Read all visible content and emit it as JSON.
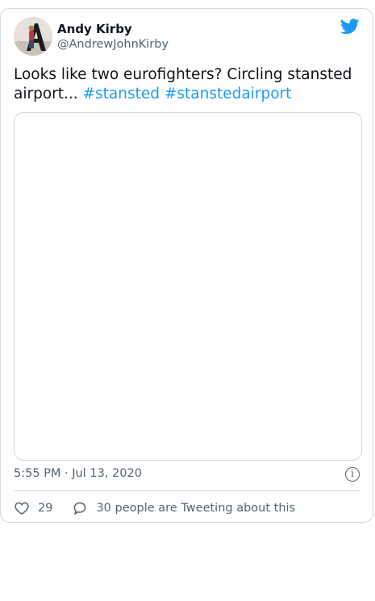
{
  "tweet": {
    "author_name": "Andy Kirby",
    "author_handle": "@AndrewJohnKirby",
    "text_prefix": "Looks like two eurofighters? Circling stansted airport... ",
    "hashtags": [
      "#stansted",
      "#stanstedairport"
    ],
    "timestamp": "5:55 PM · Jul 13, 2020",
    "likes": "29",
    "conversation_text": "30 people are Tweeting about this"
  },
  "icons": {
    "brand": "twitter-bird-icon",
    "info": "info-icon",
    "like": "heart-icon",
    "reply": "reply-bubble-icon"
  },
  "colors": {
    "accent": "#1d9bf0",
    "muted": "#536471",
    "border": "#cfd9de"
  }
}
